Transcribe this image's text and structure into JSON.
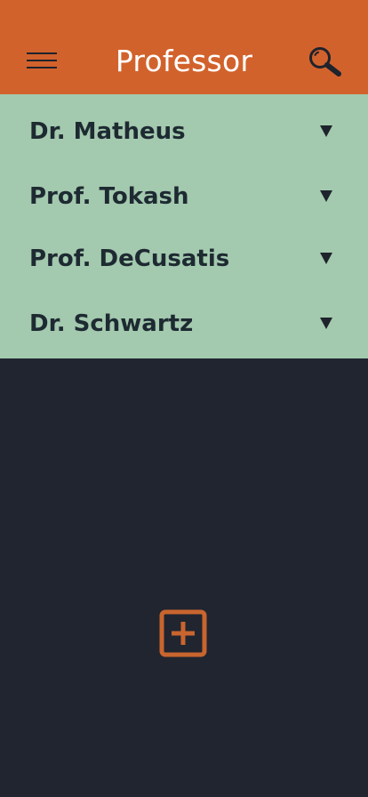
{
  "header": {
    "title": "Professor",
    "menu_icon": "hamburger-menu-icon",
    "search_icon": "search-icon"
  },
  "professors": [
    {
      "name": "Dr. Matheus",
      "icon": "chevron-down-icon"
    },
    {
      "name": "Prof. Tokash",
      "icon": "chevron-down-icon"
    },
    {
      "name": "Prof. DeCusatis",
      "icon": "chevron-down-icon"
    },
    {
      "name": "Dr. Schwartz",
      "icon": "chevron-down-icon"
    }
  ],
  "fab": {
    "icon": "add-icon"
  },
  "colors": {
    "header": "#D2622C",
    "list_background": "#A3C9AE",
    "page_background": "#202530",
    "accent": "#C9652E",
    "text_dark": "#1E2A32"
  }
}
